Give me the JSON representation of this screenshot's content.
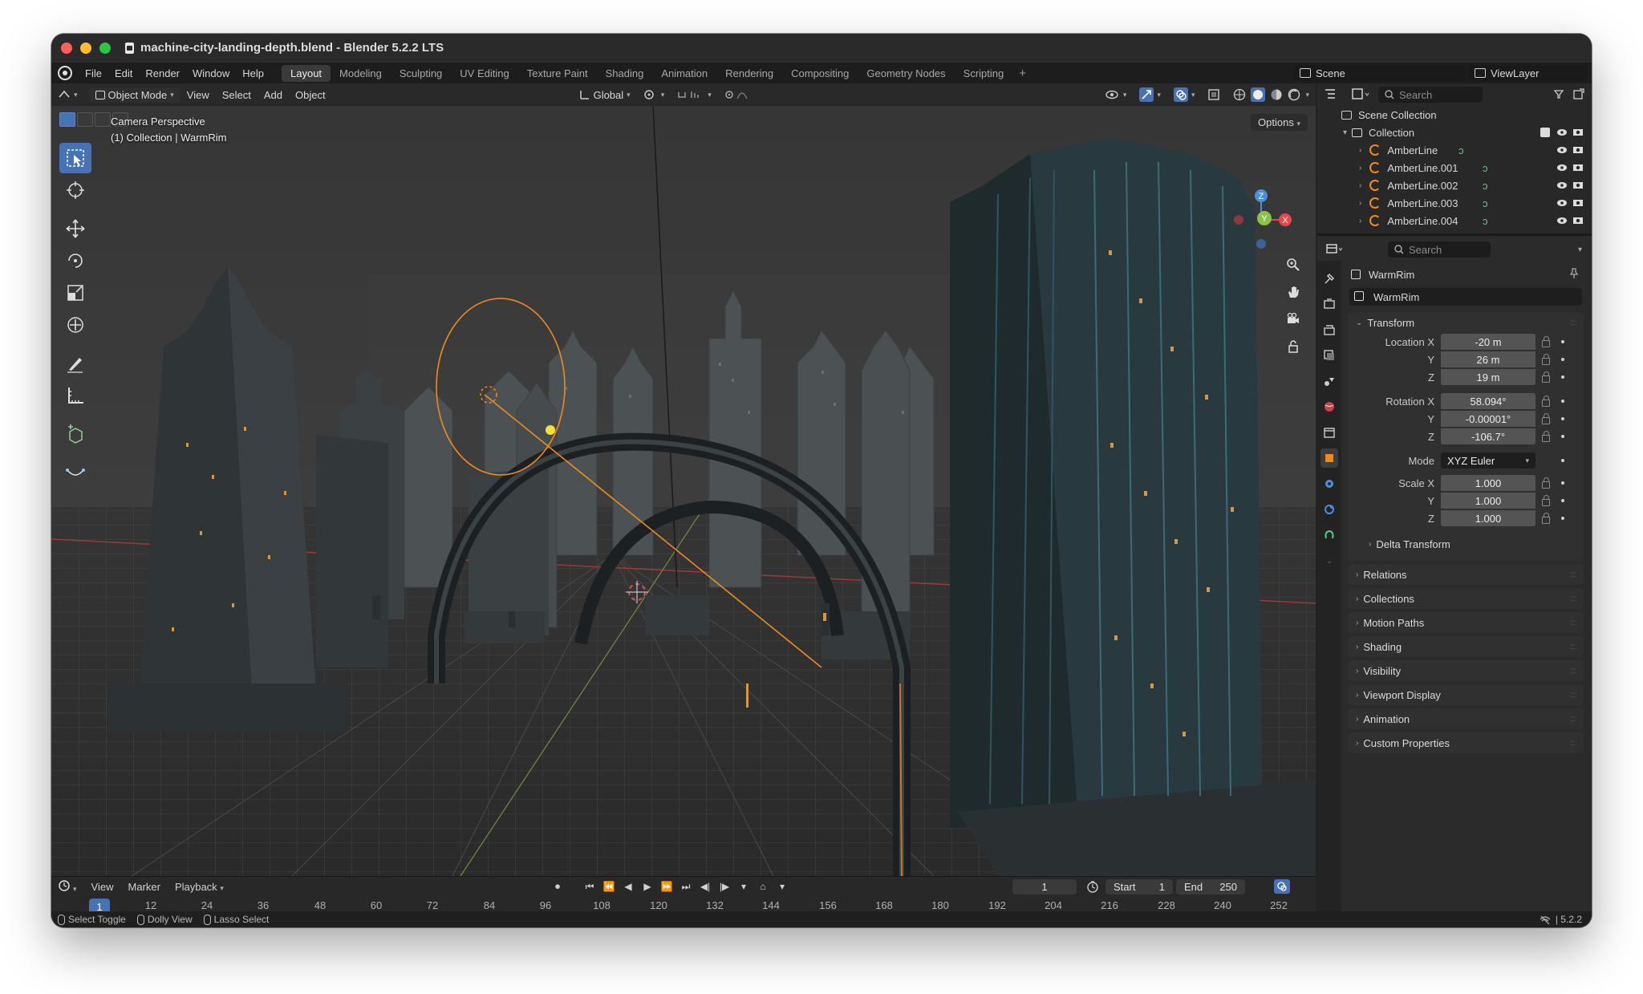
{
  "window": {
    "title": "machine-city-landing-depth.blend - Blender 5.2.2 LTS"
  },
  "menubar": {
    "menus": [
      "File",
      "Edit",
      "Render",
      "Window",
      "Help"
    ],
    "workspaces": [
      "Layout",
      "Modeling",
      "Sculpting",
      "UV Editing",
      "Texture Paint",
      "Shading",
      "Animation",
      "Rendering",
      "Compositing",
      "Geometry Nodes",
      "Scripting"
    ],
    "active_workspace": "Layout",
    "add_tab": "+",
    "scene": "Scene",
    "view_layer": "ViewLayer"
  },
  "viewport": {
    "mode": "Object Mode",
    "menus": [
      "View",
      "Select",
      "Add",
      "Object"
    ],
    "transform_orientation": "Global",
    "info_line1": "Camera Perspective",
    "info_line2": "(1) Collection | WarmRim",
    "options": "Options",
    "gizmo_x": "X",
    "gizmo_y": "Y",
    "gizmo_z": "Z"
  },
  "timeline": {
    "menus": [
      "View",
      "Marker",
      "Playback"
    ],
    "current_frame": "1",
    "start_label": "Start",
    "start": "1",
    "end_label": "End",
    "end": "250",
    "ticks": [
      "12",
      "24",
      "36",
      "48",
      "60",
      "72",
      "84",
      "96",
      "108",
      "120",
      "132",
      "144",
      "156",
      "168",
      "180",
      "192",
      "204",
      "216",
      "228",
      "240",
      "252"
    ]
  },
  "statusbar": {
    "items": [
      "Select Toggle",
      "Dolly View",
      "Lasso Select"
    ],
    "version": "5.2.2"
  },
  "outliner": {
    "search_placeholder": "Search",
    "scene_collection": "Scene Collection",
    "collection": "Collection",
    "objects": [
      "AmberLine",
      "AmberLine.001",
      "AmberLine.002",
      "AmberLine.003",
      "AmberLine.004"
    ]
  },
  "properties": {
    "search_placeholder": "Search",
    "object_name": "WarmRim",
    "data_name": "WarmRim",
    "transform": {
      "header": "Transform",
      "location_label": "Location X",
      "location": [
        "-20 m",
        "26 m",
        "19 m"
      ],
      "rotation_label": "Rotation X",
      "rotation": [
        "58.094°",
        "-0.00001°",
        "-106.7°"
      ],
      "mode_label": "Mode",
      "mode": "XYZ Euler",
      "scale_label": "Scale X",
      "scale": [
        "1.000",
        "1.000",
        "1.000"
      ],
      "y_label": "Y",
      "z_label": "Z",
      "delta": "Delta Transform"
    },
    "panels": [
      "Relations",
      "Collections",
      "Motion Paths",
      "Shading",
      "Visibility",
      "Viewport Display",
      "Animation",
      "Custom Properties"
    ]
  },
  "colors": {
    "accent": "#4772b3",
    "curve": "#f08a1c",
    "x_axis": "#e5484d",
    "y_axis": "#8bc34a",
    "z_axis": "#4c8ee0"
  }
}
